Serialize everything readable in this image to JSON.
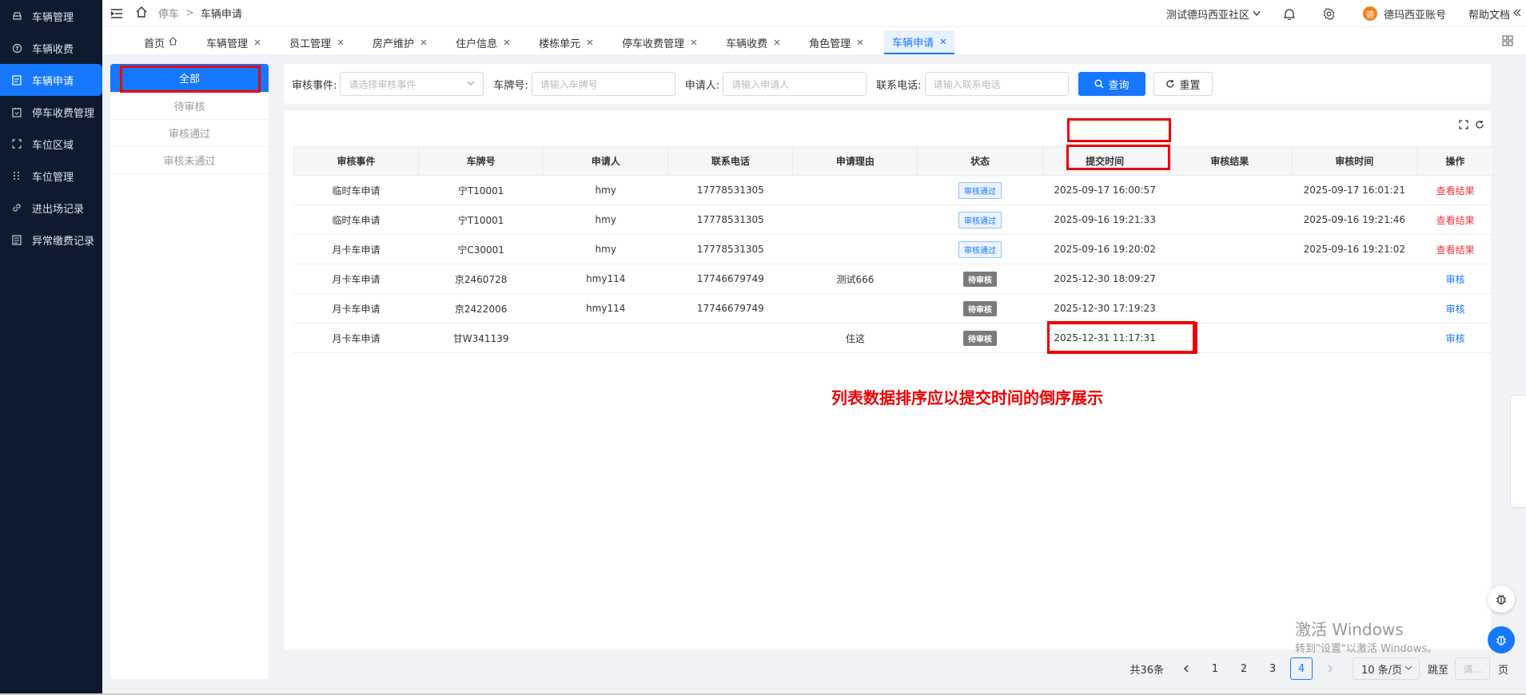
{
  "sidebar": {
    "items": [
      {
        "label": "车辆管理",
        "icon": "car-icon",
        "active": false
      },
      {
        "label": "车辆收费",
        "icon": "coin-icon",
        "active": false
      },
      {
        "label": "车辆申请",
        "icon": "form-icon",
        "active": true
      },
      {
        "label": "停车收费管理",
        "icon": "receipt-icon",
        "active": false
      },
      {
        "label": "车位区域",
        "icon": "area-icon",
        "active": false
      },
      {
        "label": "车位管理",
        "icon": "dots-icon",
        "active": false
      },
      {
        "label": "进出场记录",
        "icon": "link-icon",
        "active": false
      },
      {
        "label": "异常缴费记录",
        "icon": "doc-icon",
        "active": false
      }
    ]
  },
  "topbar": {
    "breadcrumb": [
      "停车",
      "车辆申请"
    ],
    "community": "测试德玛西亚社区",
    "account": "德玛西亚账号",
    "avatar_text": "德",
    "help": "帮助文档"
  },
  "tabs": [
    {
      "label": "首页",
      "closable": false,
      "active": false
    },
    {
      "label": "车辆管理",
      "closable": true,
      "active": false
    },
    {
      "label": "员工管理",
      "closable": true,
      "active": false
    },
    {
      "label": "房产维护",
      "closable": true,
      "active": false
    },
    {
      "label": "住户信息",
      "closable": true,
      "active": false
    },
    {
      "label": "楼栋单元",
      "closable": true,
      "active": false
    },
    {
      "label": "停车收费管理",
      "closable": true,
      "active": false
    },
    {
      "label": "车辆收费",
      "closable": true,
      "active": false
    },
    {
      "label": "角色管理",
      "closable": true,
      "active": false
    },
    {
      "label": "车辆申请",
      "closable": true,
      "active": true
    }
  ],
  "filter_panel": {
    "items": [
      "全部",
      "待审核",
      "审核通过",
      "审核未通过"
    ]
  },
  "search": {
    "event_label": "审核事件:",
    "event_placeholder": "请选择审核事件",
    "plate_label": "车牌号:",
    "plate_placeholder": "请输入车牌号",
    "applicant_label": "申请人:",
    "applicant_placeholder": "请输入申请人",
    "phone_label": "联系电话:",
    "phone_placeholder": "请输入联系电话",
    "query_label": "查询",
    "reset_label": "重置"
  },
  "table": {
    "columns": [
      "审核事件",
      "车牌号",
      "申请人",
      "联系电话",
      "申请理由",
      "状态",
      "提交时间",
      "审核结果",
      "审核时间",
      "操作"
    ],
    "rows": [
      [
        "临时车申请",
        "宁T10001",
        "hmy",
        "17778531305",
        "",
        "审核通过",
        "2025-09-17 16:00:57",
        "",
        "2025-09-17 16:01:21",
        "查看结果"
      ],
      [
        "临时车申请",
        "宁T10001",
        "hmy",
        "17778531305",
        "",
        "审核通过",
        "2025-09-16 19:21:33",
        "",
        "2025-09-16 19:21:46",
        "查看结果"
      ],
      [
        "月卡车申请",
        "宁C30001",
        "hmy",
        "17778531305",
        "",
        "审核通过",
        "2025-09-16 19:20:02",
        "",
        "2025-09-16 19:21:02",
        "查看结果"
      ],
      [
        "月卡车申请",
        "京2460728",
        "hmy114",
        "17746679749",
        "测试666",
        "待审核",
        "2025-12-30 18:09:27",
        "",
        "",
        "审核"
      ],
      [
        "月卡车申请",
        "京2422006",
        "hmy114",
        "17746679749",
        "",
        "待审核",
        "2025-12-30 17:19:23",
        "",
        "",
        "审核"
      ],
      [
        "月卡车申请",
        "甘W341139",
        "",
        "",
        "住这",
        "待审核",
        "2025-12-31 11:17:31",
        "",
        "",
        "审核"
      ]
    ]
  },
  "annotation": "列表数据排序应以提交时间的倒序展示",
  "pagination": {
    "total": "共36条",
    "pages": [
      "1",
      "2",
      "3",
      "4"
    ],
    "current": "4",
    "size": "10 条/页",
    "jump_label": "跳至",
    "jump_placeholder": "请...",
    "page_suffix": "页"
  },
  "watermark": "激活 Windows",
  "watermark_sub": "转到\"设置\"以激活 Windows。",
  "colors": {
    "primary": "#1677ff",
    "sidebar": "#0e1a2f",
    "alert": "#e00000"
  }
}
